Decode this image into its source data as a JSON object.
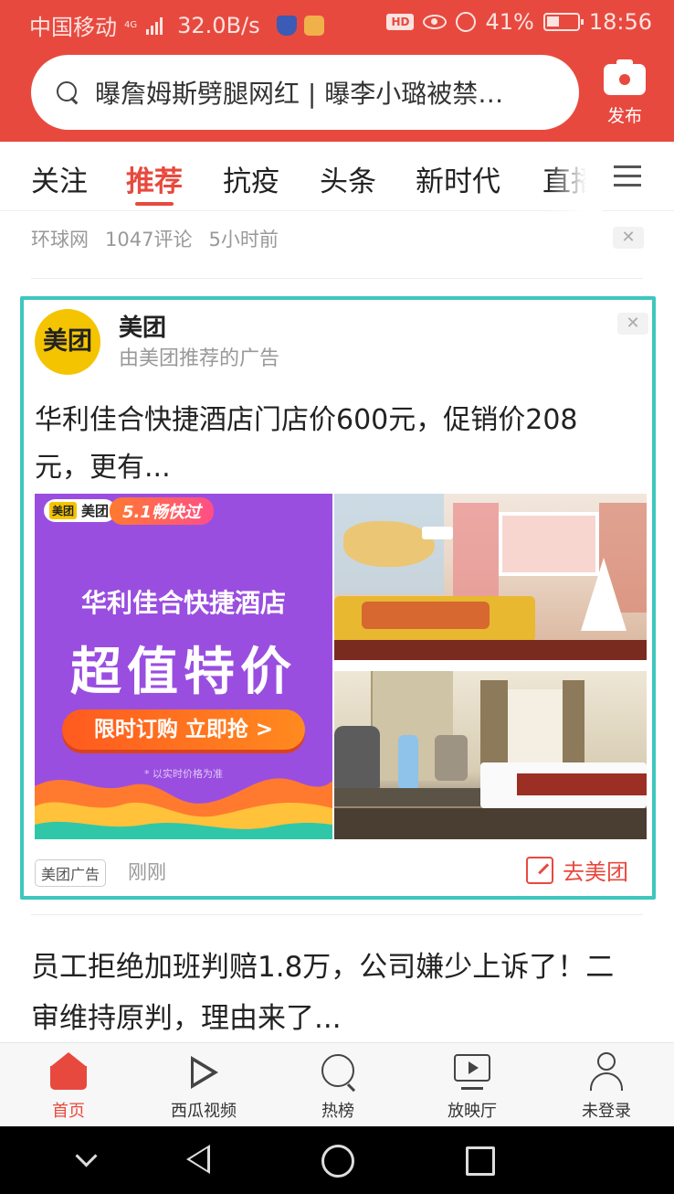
{
  "status_bar": {
    "carrier": "中国移动",
    "net_type": "4G",
    "speed": "32.0B/s",
    "battery": "41%",
    "time": "18:56",
    "hd_label": "HD"
  },
  "search": {
    "text": "曝詹姆斯劈腿网红 | 曝李小璐被禁…",
    "publish_label": "发布"
  },
  "tabs": [
    "关注",
    "推荐",
    "抗疫",
    "头条",
    "新时代",
    "直播"
  ],
  "active_tab": "推荐",
  "prev_item": {
    "source": "环球网",
    "comments": "1047评论",
    "time": "5小时前"
  },
  "ad": {
    "logo_text": "美团",
    "advertiser": "美团",
    "subtitle": "由美团推荐的广告",
    "title": "华利佳合快捷酒店门店价600元，促销价208元，更有...",
    "banner": {
      "brand": "美团",
      "brand_tag": "美团",
      "badge": "5.1畅快过",
      "hotel_name": "华利佳合快捷酒店",
      "headline": "超值特价",
      "cta": "限时订购 立即抢 >",
      "note": "* 以实时价格为准"
    },
    "tag": "美团广告",
    "time": "刚刚",
    "goto_label": "去美团"
  },
  "next_article": {
    "title": "员工拒绝加班判赔1.8万，公司嫌少上诉了！二审维持原判，理由来了..."
  },
  "bottom_nav": [
    {
      "label": "首页",
      "icon": "home-icon"
    },
    {
      "label": "西瓜视频",
      "icon": "play-icon"
    },
    {
      "label": "热榜",
      "icon": "trending-icon"
    },
    {
      "label": "放映厅",
      "icon": "tv-icon"
    },
    {
      "label": "未登录",
      "icon": "user-icon"
    }
  ],
  "colors": {
    "brand_red": "#e8493f",
    "ad_frame": "#3dc7be",
    "meituan_yellow": "#f5c400",
    "promo_purple": "#9a4ee0"
  }
}
